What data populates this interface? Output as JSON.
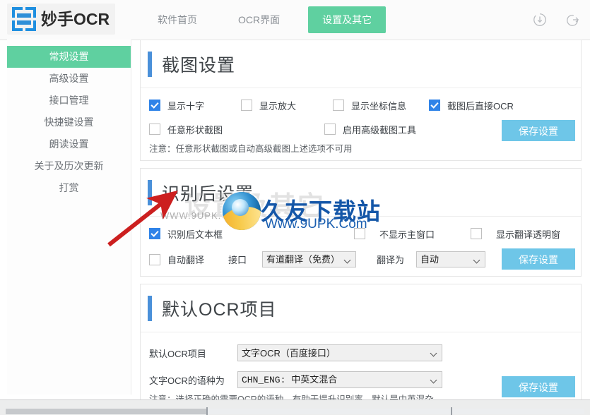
{
  "header": {
    "brand": "妙手OCR",
    "nav": [
      {
        "label": "软件首页",
        "active": false
      },
      {
        "label": "OCR界面",
        "active": false
      },
      {
        "label": "设置及其它",
        "active": true
      }
    ],
    "icons": [
      {
        "name": "download-icon"
      },
      {
        "name": "logout-icon"
      }
    ]
  },
  "sidebar": {
    "items": [
      {
        "label": "常规设置",
        "active": true
      },
      {
        "label": "高级设置",
        "active": false
      },
      {
        "label": "接口管理",
        "active": false
      },
      {
        "label": "快捷键设置",
        "active": false
      },
      {
        "label": "朗读设置",
        "active": false
      },
      {
        "label": "关于及历次更新",
        "active": false
      },
      {
        "label": "打赏",
        "active": false
      }
    ]
  },
  "panel1": {
    "title": "截图设置",
    "checkboxes_row1": [
      {
        "label": "显示十字",
        "checked": true
      },
      {
        "label": "显示放大",
        "checked": false
      },
      {
        "label": "显示坐标信息",
        "checked": false
      },
      {
        "label": "截图后直接OCR",
        "checked": true
      }
    ],
    "checkboxes_row2": [
      {
        "label": "任意形状截图",
        "checked": false
      },
      {
        "label": "启用高级截图工具",
        "checked": false
      }
    ],
    "note": "注意：任意形状截图或自动高级截图上述选项不可用",
    "save_label": "保存设置"
  },
  "panel2": {
    "title": "识别后设置",
    "cb_text_box": {
      "label": "识别后文本框",
      "checked": true
    },
    "cb_hide_main": {
      "label": "不显示主窗口",
      "checked": false
    },
    "cb_transparent": {
      "label": "显示翻译透明窗",
      "checked": false
    },
    "cb_auto_translate": {
      "label": "自动翻译",
      "checked": false
    },
    "api_label": "接口",
    "api_value": "有道翻译（免费）",
    "translate_to_label": "翻译为",
    "translate_to_value": "自动",
    "save_label": "保存设置"
  },
  "panel3": {
    "title": "默认OCR项目",
    "default_ocr_label": "默认OCR项目",
    "default_ocr_value": "文字OCR（百度接口）",
    "lang_label": "文字OCR的语种为",
    "lang_value": "CHN_ENG: 中英文混合",
    "note": "注意：选择正确的需要OCR的语种，有助于提升识别率，默认是中英混杂。",
    "save_label": "保存设置"
  },
  "watermark": {
    "ghost_text": "设置及其它",
    "url_grey": "WWW.9UPK.COM",
    "site_cn": "久友下载站",
    "site_en": "Www.9UPK.Com"
  },
  "colors": {
    "nav_active": "#5fd0a0",
    "panel_accent": "#4a90d9",
    "checkbox_on": "#2f83e8",
    "save_button": "#6ec6e8",
    "arrow": "#cc1f1f"
  }
}
